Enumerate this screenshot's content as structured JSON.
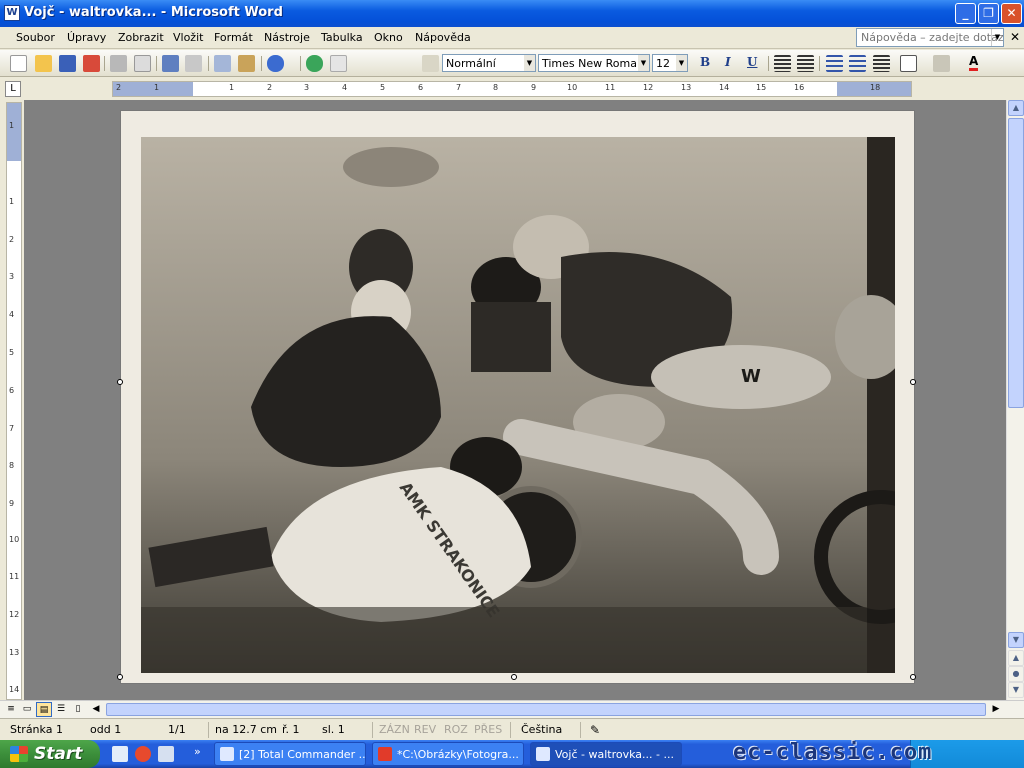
{
  "window": {
    "title": "Vojč - waltrovka... - Microsoft Word",
    "app_icon": "W"
  },
  "menu": {
    "items": [
      "Soubor",
      "Úpravy",
      "Zobrazit",
      "Vložit",
      "Formát",
      "Nástroje",
      "Tabulka",
      "Okno",
      "Nápověda"
    ],
    "help_placeholder": "Nápověda – zadejte dotaz"
  },
  "toolbar": {
    "style": "Normální",
    "font": "Times New Roman",
    "size": "12",
    "bold": "B",
    "italic": "I",
    "underline": "U",
    "font_color": "A"
  },
  "ruler": {
    "tab_selector": "L",
    "h_numbers": [
      "2",
      "1",
      "1",
      "2",
      "3",
      "4",
      "5",
      "6",
      "7",
      "8",
      "9",
      "10",
      "11",
      "12",
      "13",
      "14",
      "15",
      "16",
      "17",
      "18"
    ],
    "v_numbers": [
      "1",
      "1",
      "2",
      "3",
      "4",
      "5",
      "6",
      "7",
      "8",
      "9",
      "10",
      "11",
      "12",
      "13",
      "14"
    ]
  },
  "photo": {
    "jersey_text": "AMK STRAKONICE",
    "tank_logo": "W"
  },
  "status": {
    "page": "Stránka  1",
    "section": "odd  1",
    "page_of": "1/1",
    "position": "na  12.7 cm",
    "line": "ř.  1",
    "column": "sl.  1",
    "rec": "ZÁZN",
    "trk": "REV",
    "ext": "ROZ",
    "ovr": "PŘES",
    "language": "Čeština"
  },
  "taskbar": {
    "start": "Start",
    "items": [
      "[2] Total Commander ...",
      "*C:\\Obrázky\\Fotogra...",
      "Vojč - waltrovka... - ..."
    ]
  },
  "watermark": "ec-classic.com",
  "colors": {
    "titlebar": "#0A5BE0",
    "taskbar": "#245EDB",
    "start": "#3C8F3B",
    "close": "#D9522B"
  }
}
